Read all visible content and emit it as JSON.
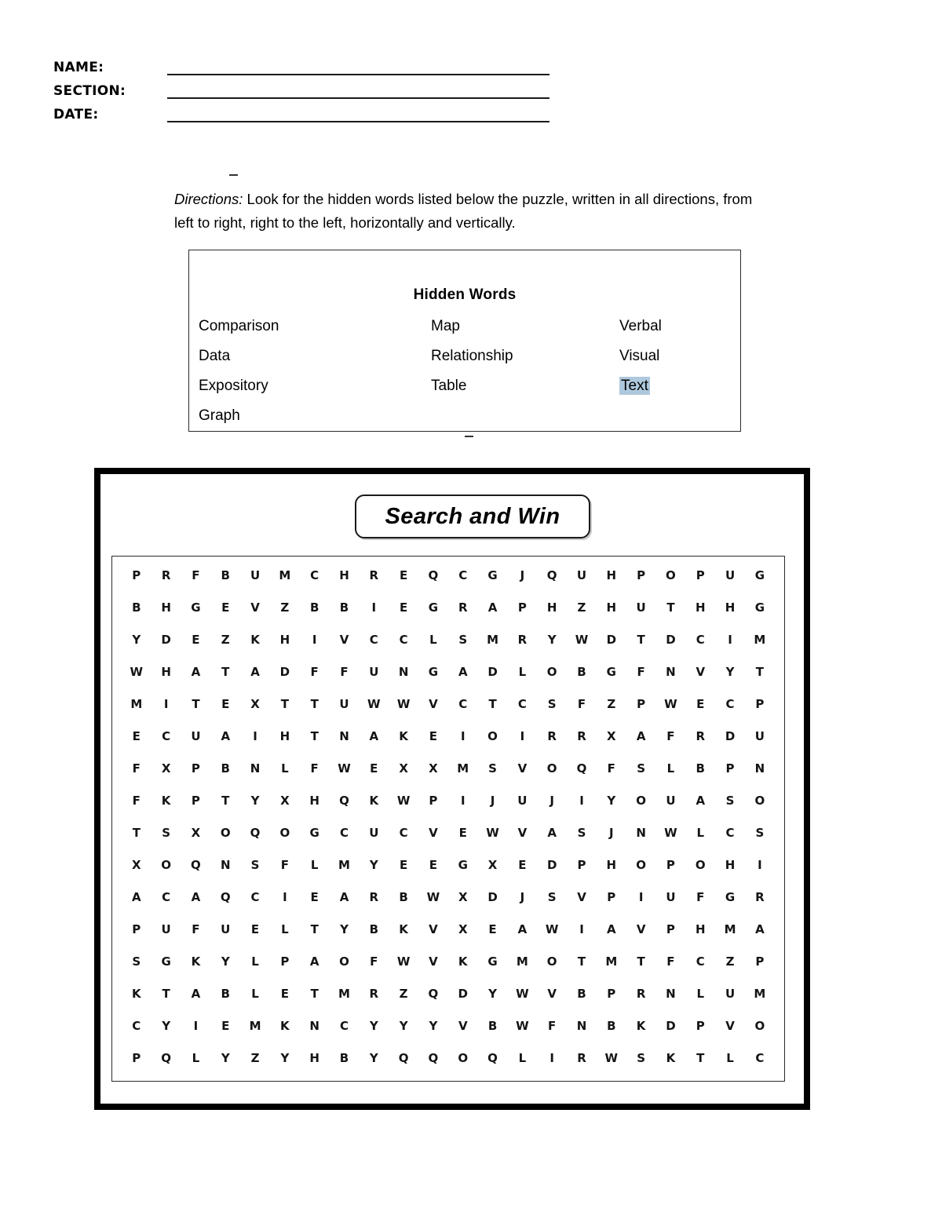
{
  "header": {
    "fields": [
      {
        "label": "NAME:"
      },
      {
        "label": "SECTION:"
      },
      {
        "label": "DATE:"
      }
    ]
  },
  "directions": {
    "lead": "Directions:",
    "text": " Look for the hidden words listed below the puzzle, written in all directions, from left to right, right to the left, horizontally and vertically."
  },
  "hidden_words": {
    "title": "Hidden Words",
    "highlight_color": "#aec8dd",
    "rows": [
      {
        "col1": "Comparison",
        "col2": "Map",
        "col3": "Verbal",
        "col3_highlighted": false
      },
      {
        "col1": "Data",
        "col2": "Relationship",
        "col3": "Visual",
        "col3_highlighted": false
      },
      {
        "col1": "Expository",
        "col2": "Table",
        "col3": "Text",
        "col3_highlighted": true
      },
      {
        "col1": "Graph",
        "col2": "",
        "col3": "",
        "col3_highlighted": false
      }
    ],
    "words": [
      "Comparison",
      "Data",
      "Expository",
      "Graph",
      "Map",
      "Relationship",
      "Table",
      "Verbal",
      "Visual",
      "Text"
    ]
  },
  "puzzle": {
    "banner_title": "Search and Win",
    "rows": 16,
    "columns": 22,
    "grid": [
      "P R F B U M C H R E Q C G J Q U H P O P U G",
      "B H G E V Z B B I E G R A P H Z H U T H H G",
      "Y D E Z K H I V C C L S M R Y W D T D C I M",
      "W H A T A D F F U N G A D L O B G F N V Y T",
      "M I T E X T T U W W V C T C S F Z P W E C P",
      "E C U A I H T N A K E I O I R R X A F R D U",
      "F X P B N L F W E X X M S V O Q F S L B P N",
      "F K P T Y X H Q K W P I J U J I Y O U A S O",
      "T S X O Q O G C U C V E W V A S J N W L C S",
      "X O Q N S F L M Y E E G X E D P H O P O H I",
      "A C A Q C I E A R B W X D J S V P I U F G R",
      "P U F U E L T Y B K V X E A W I A V P H M A",
      "S G K Y L P A O F W V K G M O T M T F C Z P",
      "K T A B L E T M R Z Q D Y W V B P R N L U M",
      "C Y I E M K N C Y Y Y V B W F N B K D P V O",
      "P Q L Y Z Y H B Y Q Q O Q L I R W S K T L C"
    ]
  }
}
